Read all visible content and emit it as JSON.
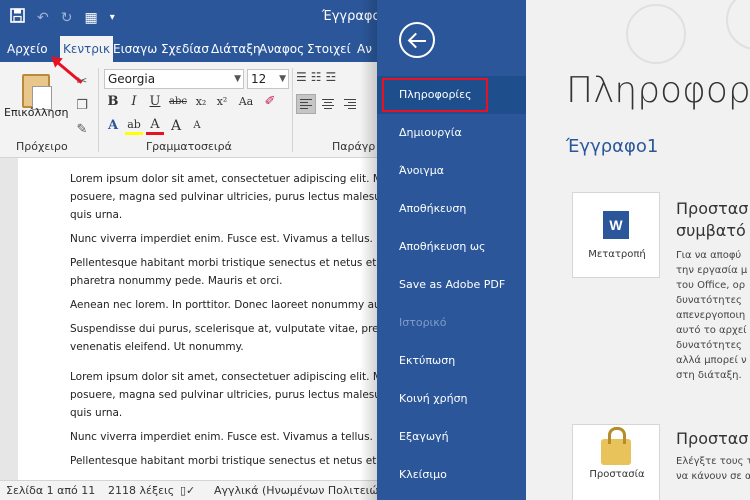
{
  "title_bar": {
    "doc_title": "Έγγραφο",
    "save_icon": "save-icon",
    "undo_icon": "undo-icon",
    "redo_icon": "redo-icon",
    "format_painter_icon": "touch-mode-icon",
    "customize_icon": "customize-qat-icon"
  },
  "tabs": [
    "Αρχείο",
    "Κεντρικ",
    "Εισαγω",
    "Σχεδίασ",
    "Διάταξη",
    "Αναφος",
    "Στοιχεί",
    "Αν"
  ],
  "ribbon": {
    "paste_label": "Επικόλληση",
    "clipboard_group": "Πρόχειρο",
    "font_name": "Georgia",
    "font_size": "12",
    "font_group": "Γραμματοσειρά",
    "paragraph_group": "Παράγρ",
    "bold": "B",
    "italic": "I",
    "underline": "U",
    "strike": "abc",
    "subscript": "x₂",
    "superscript": "x²",
    "font_color_letter": "A",
    "highlight_letter": "ab",
    "grow_font": "A",
    "shrink_font": "A",
    "change_case": "Aa"
  },
  "document": {
    "paragraphs": [
      [
        "Lorem ipsum dolor sit amet, consectetuer adipiscing elit. Ma",
        "posuere, magna sed pulvinar ultricies, purus lectus malesua",
        "quis urna."
      ],
      [
        "Nunc viverra imperdiet enim. Fusce est. Vivamus a tellus."
      ],
      [
        "Pellentesque habitant morbi tristique senectus et netus et",
        "pharetra nonummy pede. Mauris et orci."
      ],
      [
        "Aenean nec lorem. In porttitor. Donec laoreet nonummy au"
      ],
      [
        "Suspendisse dui purus, scelerisque at, vulputate vitae, preti",
        "venenatis eleifend. Ut nonummy."
      ],
      [
        "Lorem ipsum dolor sit amet, consectetuer adipiscing elit. Ma",
        "posuere, magna sed pulvinar ultricies, purus lectus malesua",
        "quis urna."
      ],
      [
        "Nunc viverra imperdiet enim. Fusce est. Vivamus a tellus."
      ],
      [
        "Pellentesque habitant morbi tristique senectus et netus et"
      ]
    ]
  },
  "status_bar": {
    "page": "Σελίδα 1 από 11",
    "words": "2118 λέξεις",
    "language": "Αγγλικά (Ηνωμένων Πολιτειών)"
  },
  "backstage": {
    "nav": [
      {
        "label": "Πληροφορίες",
        "state": "selected"
      },
      {
        "label": "Δημιουργία",
        "state": "normal"
      },
      {
        "label": "Άνοιγμα",
        "state": "normal"
      },
      {
        "label": "Αποθήκευση",
        "state": "normal"
      },
      {
        "label": "Αποθήκευση ως",
        "state": "normal"
      },
      {
        "label": "Save as Adobe PDF",
        "state": "normal"
      },
      {
        "label": "Ιστορικό",
        "state": "disabled"
      },
      {
        "label": "Εκτύπωση",
        "state": "normal"
      },
      {
        "label": "Κοινή χρήση",
        "state": "normal"
      },
      {
        "label": "Εξαγωγή",
        "state": "normal"
      },
      {
        "label": "Κλείσιμο",
        "state": "normal"
      }
    ],
    "heading": "Πληροφορ",
    "doc_name": "Έγγραφο1",
    "sections": [
      {
        "tile_label": "Μετατροπή",
        "title_lines": [
          "Προστασ",
          "συμβατό"
        ],
        "desc_lines": [
          "Για να αποφύ",
          "την εργασία μ",
          "του Office, ορ",
          "δυνατότητες",
          "απενεργοποιη",
          "αυτό το αρχεί",
          "δυνατότητες",
          "αλλά μπορεί ν",
          "στη διάταξη."
        ]
      },
      {
        "tile_label": "Προστασία",
        "title_lines": [
          "Προστασ"
        ],
        "desc_lines": [
          "Ελέγξτε τους τ",
          "να κάνουν σε α"
        ]
      }
    ]
  }
}
